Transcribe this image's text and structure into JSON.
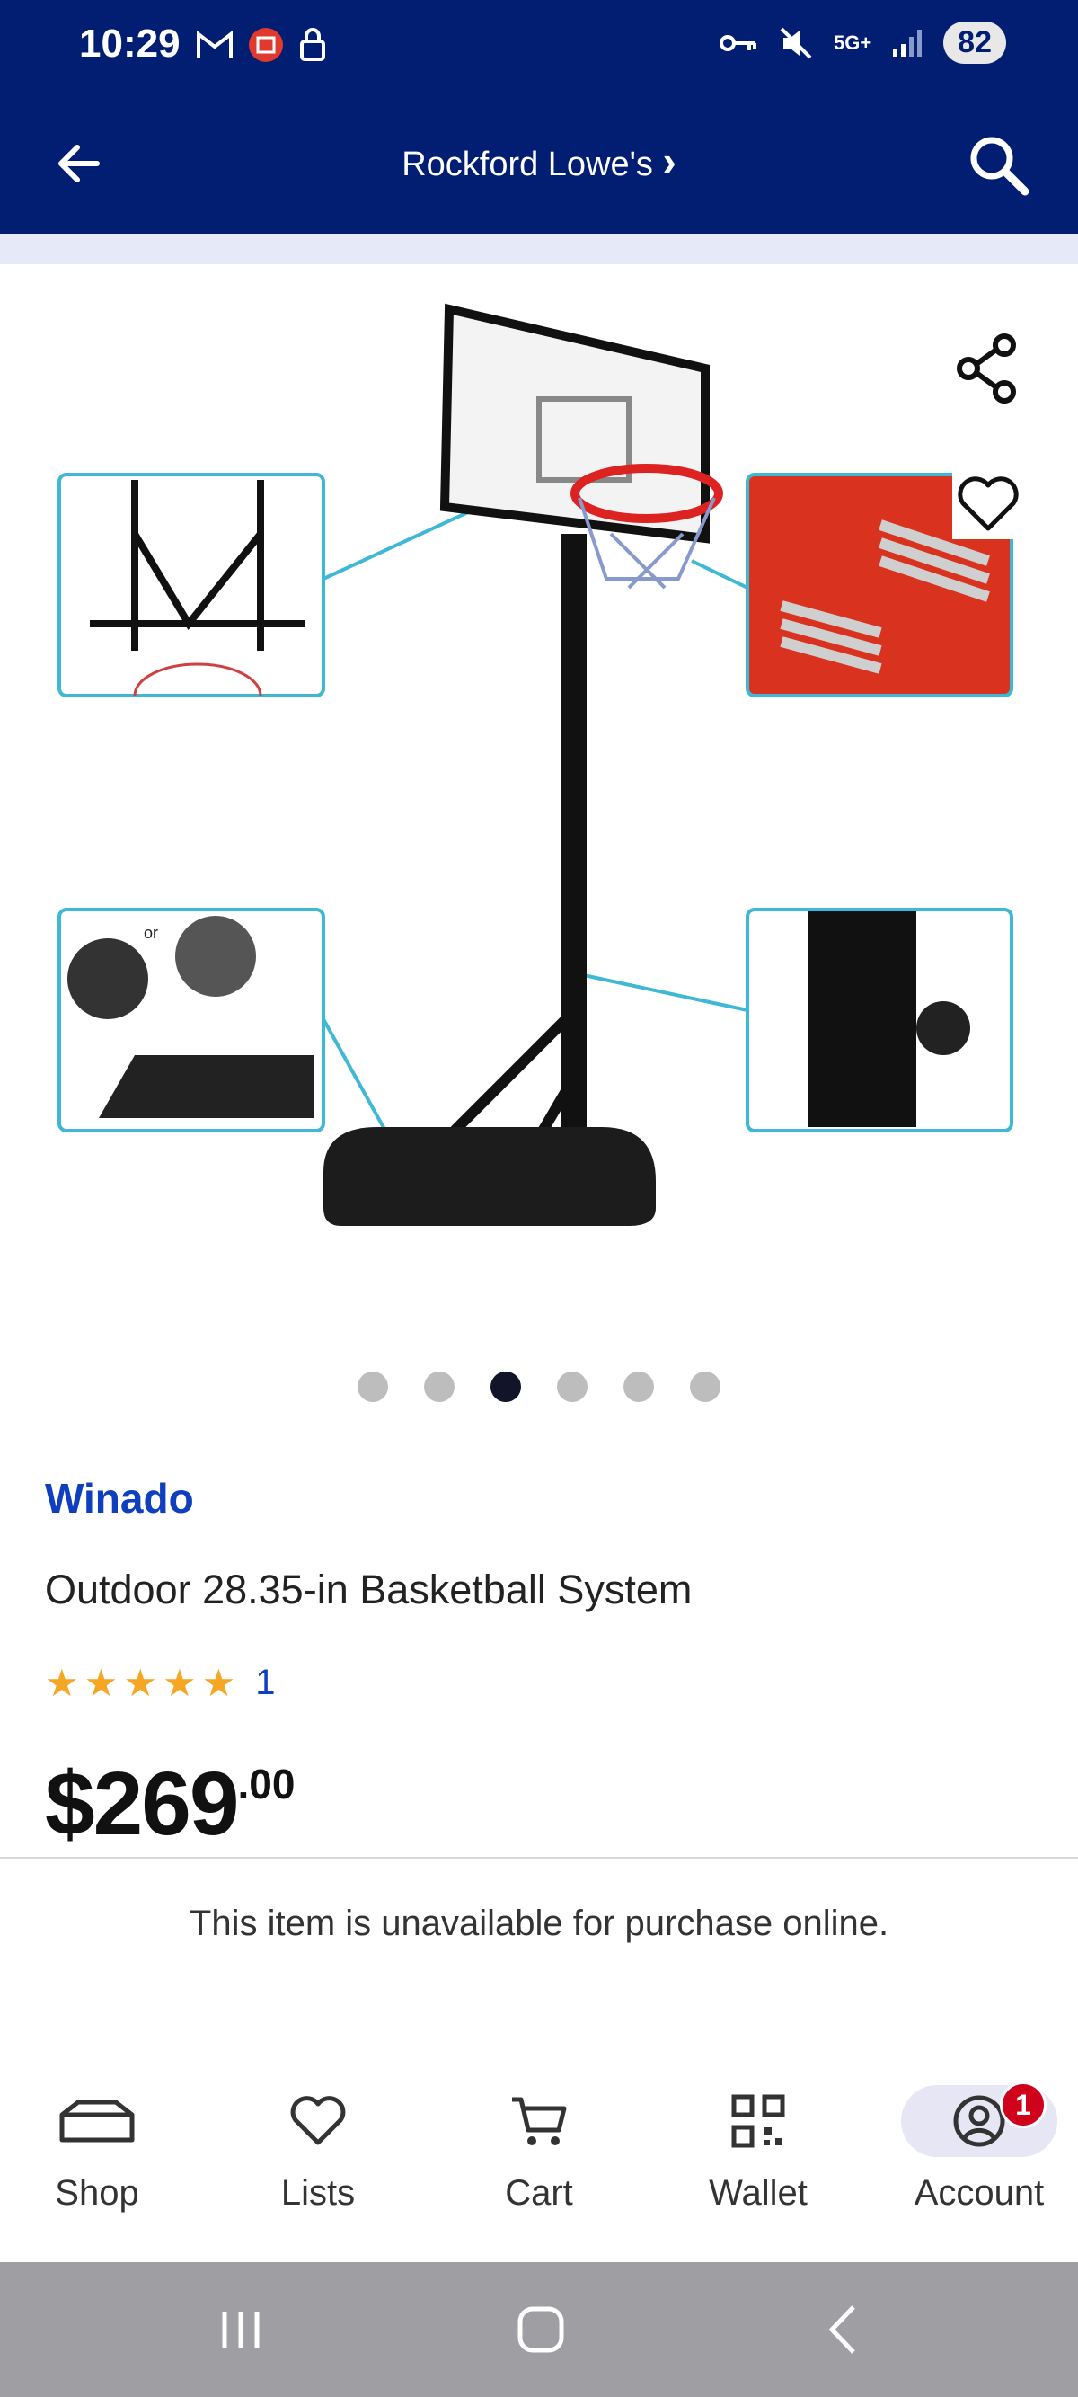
{
  "status_bar": {
    "time": "10:29",
    "network": "5G+",
    "battery": "82"
  },
  "header": {
    "store_name": "Rockford Lowe's",
    "store_chevron": "›"
  },
  "product": {
    "brand": "Winado",
    "title": "Outdoor 28.35-in Basketball System",
    "rating_stars": 5,
    "rating_count": "1",
    "price_main": "$269",
    "price_cents": ".00",
    "availability": "This item is unavailable for purchase online.",
    "image_count": 6,
    "active_image_index": 2
  },
  "colors": {
    "header_bg": "#011e73",
    "brand_blue": "#0f3fbe",
    "star": "#f5a623",
    "badge": "#d0021b"
  },
  "bottom_nav": [
    {
      "label": "Shop",
      "icon": "shop-icon"
    },
    {
      "label": "Lists",
      "icon": "heart-icon"
    },
    {
      "label": "Cart",
      "icon": "cart-icon"
    },
    {
      "label": "Wallet",
      "icon": "qr-icon"
    },
    {
      "label": "Account",
      "icon": "account-icon",
      "badge": "1",
      "active": true
    }
  ]
}
